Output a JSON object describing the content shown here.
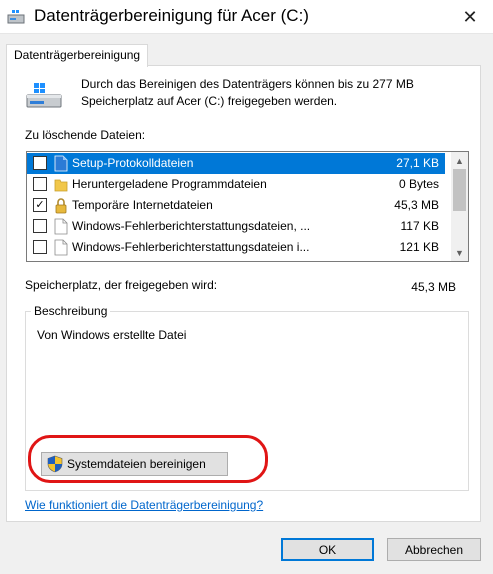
{
  "window": {
    "title": "Datenträgerbereinigung für Acer (C:)",
    "close_glyph": "✕"
  },
  "tabs": [
    {
      "label": "Datenträgerbereinigung",
      "selected": true
    }
  ],
  "intro_text": "Durch das Bereinigen des Datenträgers können bis zu 277 MB Speicherplatz auf Acer (C:) freigegeben werden.",
  "files_label": "Zu löschende Dateien:",
  "files": [
    {
      "name": "Setup-Protokolldateien",
      "size": "27,1 KB",
      "checked": false,
      "selected": true,
      "icon": "file-icon"
    },
    {
      "name": "Heruntergeladene Programmdateien",
      "size": "0 Bytes",
      "checked": false,
      "selected": false,
      "icon": "folder-icon"
    },
    {
      "name": "Temporäre Internetdateien",
      "size": "45,3 MB",
      "checked": true,
      "selected": false,
      "icon": "lock-icon"
    },
    {
      "name": "Windows-Fehlerberichterstattungsdateien, ...",
      "size": "117 KB",
      "checked": false,
      "selected": false,
      "icon": "file-icon"
    },
    {
      "name": "Windows-Fehlerberichterstattungsdateien i...",
      "size": "121 KB",
      "checked": false,
      "selected": false,
      "icon": "file-icon"
    }
  ],
  "space_label": "Speicherplatz, der freigegeben wird:",
  "space_value": "45,3 MB",
  "description": {
    "legend": "Beschreibung",
    "text": "Von Windows erstellte Datei"
  },
  "system_files_button": "Systemdateien bereinigen",
  "help_link": "Wie funktioniert die Datenträgerbereinigung?",
  "buttons": {
    "ok": "OK",
    "cancel": "Abbrechen"
  },
  "colors": {
    "selection": "#0078d7",
    "link": "#0066cc",
    "highlight_oval": "#e01515"
  }
}
